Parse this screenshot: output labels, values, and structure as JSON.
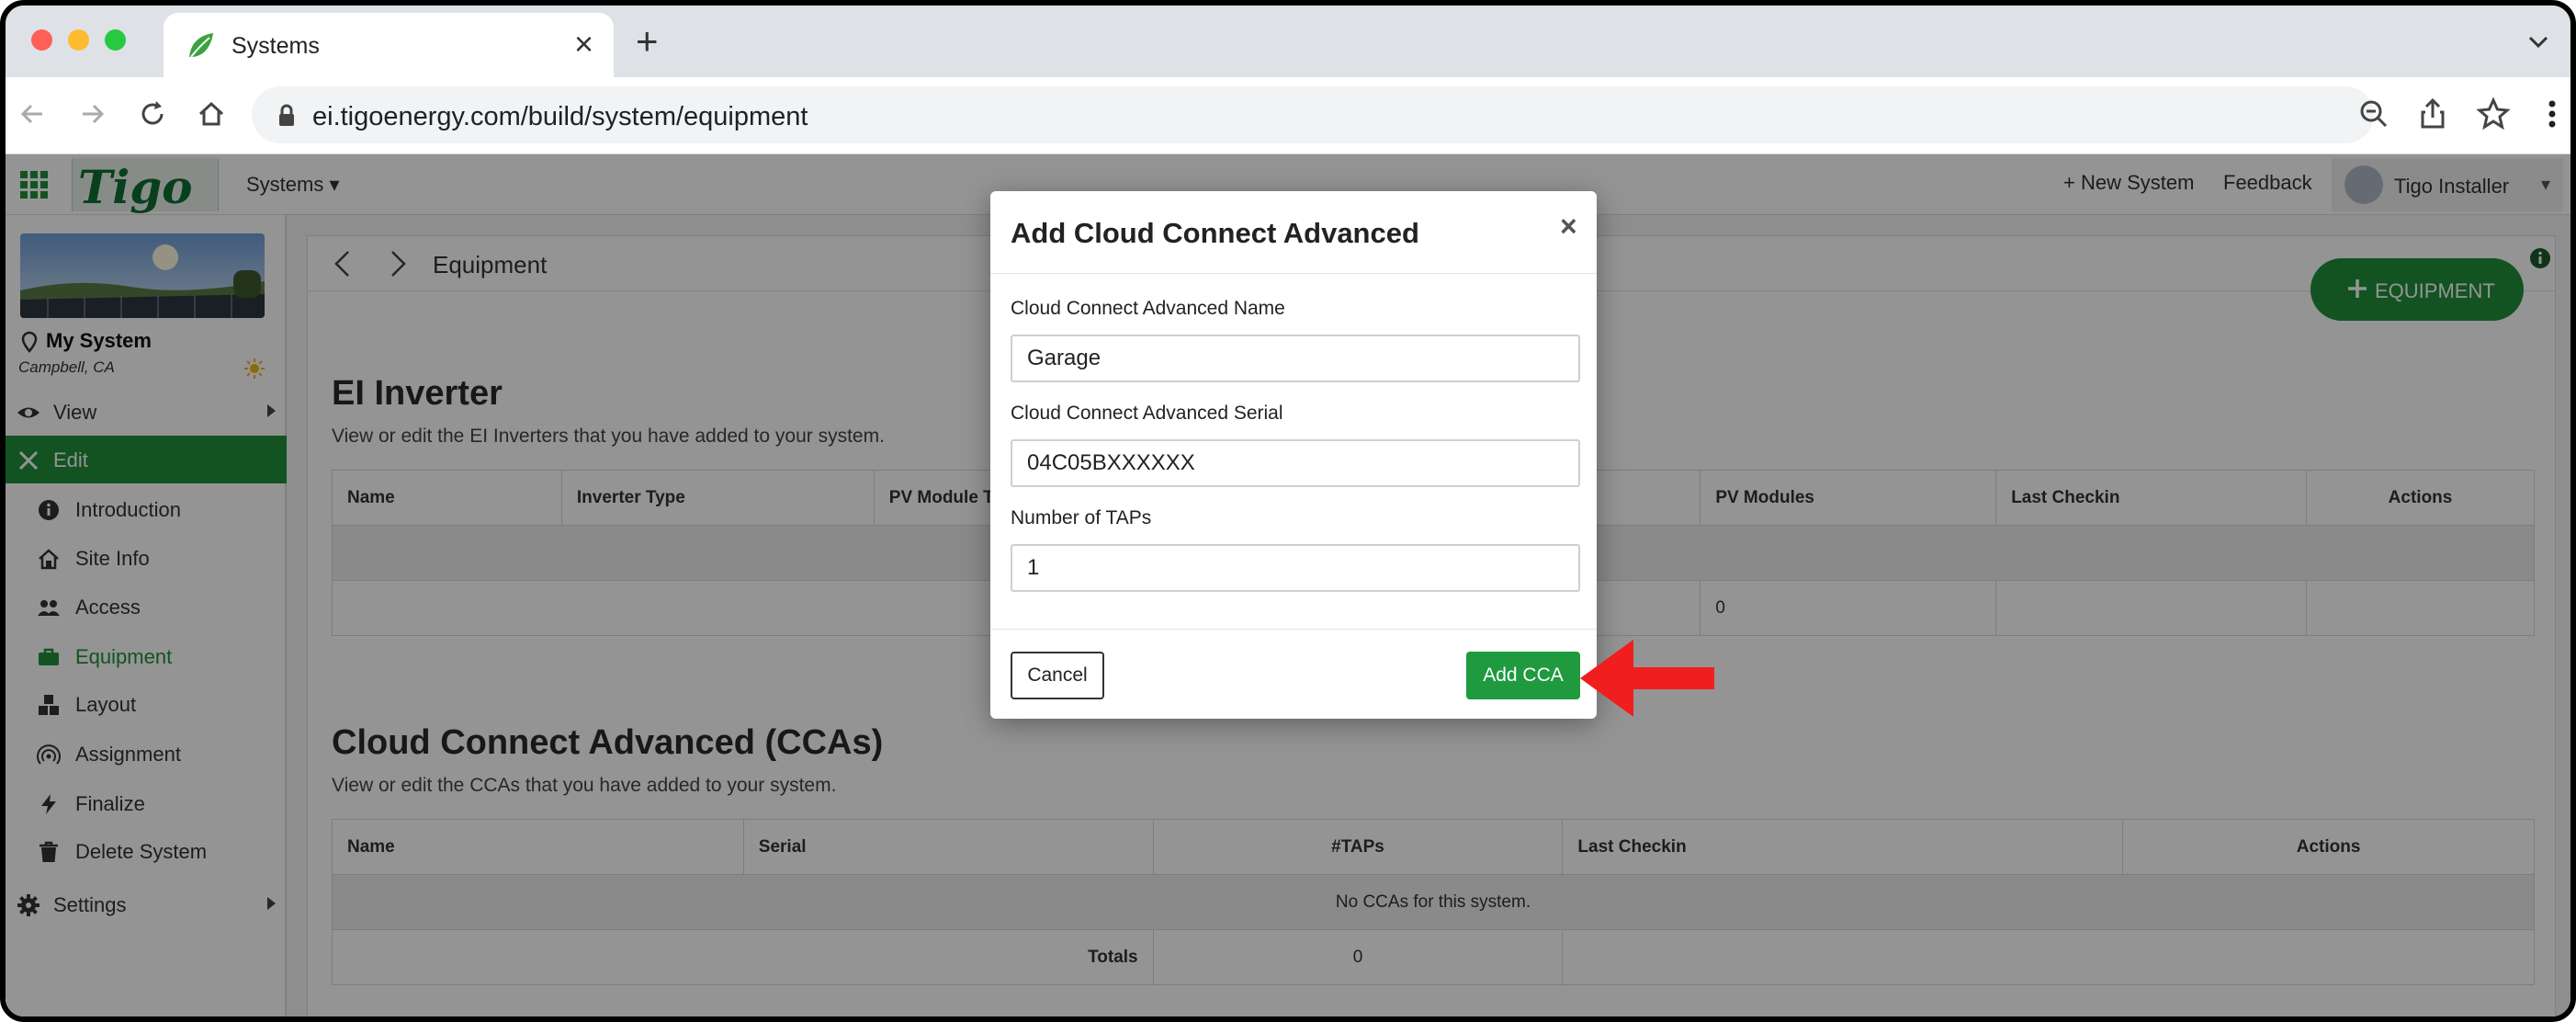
{
  "browser": {
    "tab_title": "Systems",
    "url": "ei.tigoenergy.com/build/system/equipment"
  },
  "app": {
    "logo_text": "Tigo",
    "nav": {
      "systems": "Systems ▾",
      "new_system": "+ New System",
      "feedback": "Feedback",
      "user": "Tigo Installer"
    }
  },
  "sidebar": {
    "system_name": "My System",
    "system_location": "Campbell, CA",
    "view": "View",
    "edit": "Edit",
    "items": [
      "Introduction",
      "Site Info",
      "Access",
      "Equipment",
      "Layout",
      "Assignment",
      "Finalize",
      "Delete System"
    ],
    "settings": "Settings"
  },
  "main": {
    "breadcrumb": "Equipment",
    "add_equipment": "EQUIPMENT",
    "inverter_section": {
      "title": "EI Inverter",
      "subtitle": "View or edit the EI Inverters that you have added to your system.",
      "headers": [
        "Name",
        "Inverter Type",
        "PV Module T",
        "PV Modules",
        "Last Checkin",
        "Actions"
      ],
      "totals_pv_modules": "0"
    },
    "cca_section": {
      "title": "Cloud Connect Advanced (CCAs)",
      "subtitle": "View or edit the CCAs that you have added to your system.",
      "headers": [
        "Name",
        "Serial",
        "#TAPs",
        "Last Checkin",
        "Actions"
      ],
      "empty": "No CCAs for this system.",
      "totals_label": "Totals",
      "totals_taps": "0"
    }
  },
  "modal": {
    "title": "Add Cloud Connect Advanced",
    "close": "×",
    "name_label": "Cloud Connect Advanced Name",
    "name_value": "Garage",
    "serial_label": "Cloud Connect Advanced Serial",
    "serial_value": "04C05BXXXXXX",
    "taps_label": "Number of TAPs",
    "taps_value": "1",
    "cancel": "Cancel",
    "submit": "Add CCA"
  },
  "colors": {
    "brand_green": "#1f8f3a",
    "annotation_arrow": "#f01e1e"
  }
}
